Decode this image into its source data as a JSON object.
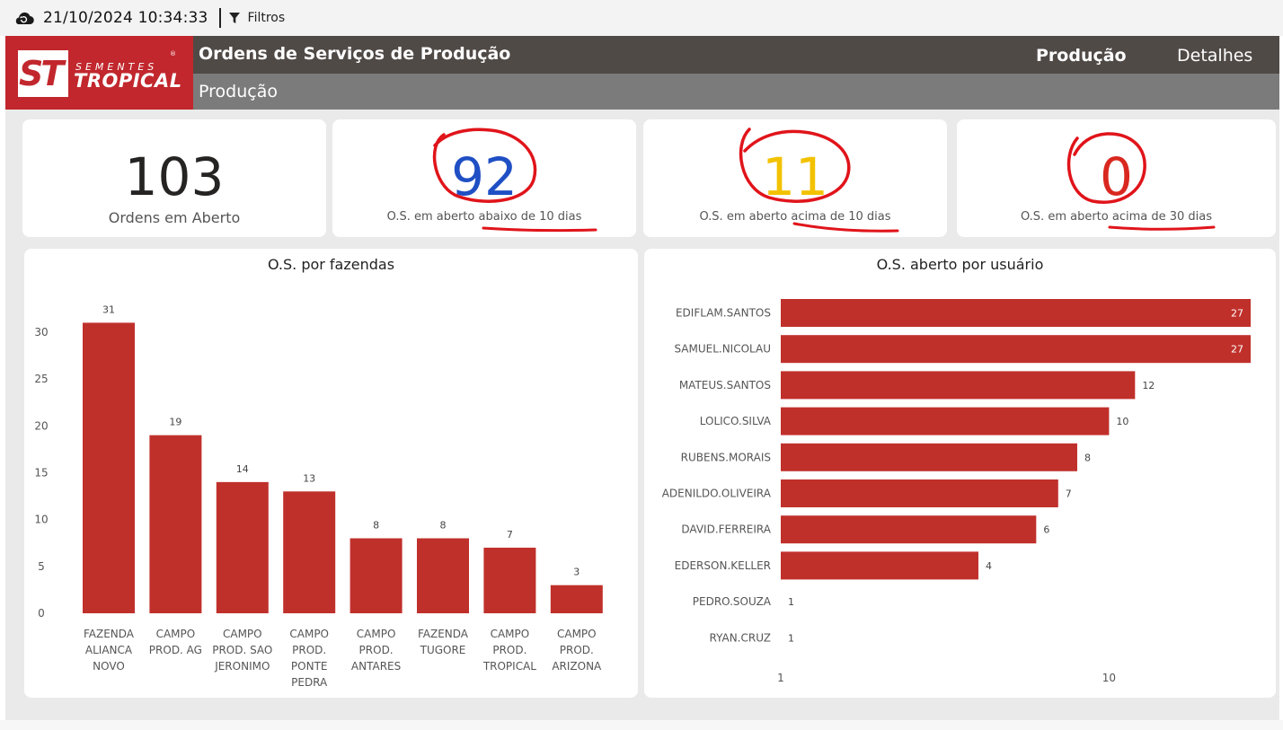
{
  "toolbar": {
    "refresh_icon": "cloud-refresh-icon",
    "timestamp": "21/10/2024 10:34:33",
    "filter_icon": "filter-icon",
    "filter_label": "Filtros"
  },
  "header": {
    "logo_mark": "ST",
    "logo_top": "SEMENTES",
    "logo_bottom": "TROPICAL",
    "logo_reg": "®",
    "title": "Ordens de Serviços de Produção",
    "subtitle": "Produção",
    "nav": [
      {
        "label": "Produção",
        "active": true
      },
      {
        "label": "Detalhes",
        "active": false
      }
    ]
  },
  "kpis": [
    {
      "value": "103",
      "label": "Ordens em Aberto",
      "color": "#252423"
    },
    {
      "value": "92",
      "label": "O.S. em aberto abaixo de 10 dias",
      "color": "#1f4fc4"
    },
    {
      "value": "11",
      "label": "O.S. em aberto acima de 10 dias",
      "color": "#f2c200"
    },
    {
      "value": "0",
      "label": "O.S. em aberto acima de 30 dias",
      "color": "#d9281f"
    }
  ],
  "colors": {
    "bar": "#c0302b",
    "accent_red": "#c1272d",
    "annotation_red": "#e0141a"
  },
  "chart_data": [
    {
      "type": "bar",
      "title": "O.S. por fazendas",
      "categories": [
        [
          "FAZENDA",
          "ALIANCA",
          "NOVO"
        ],
        [
          "CAMPO",
          "PROD. AG"
        ],
        [
          "CAMPO",
          "PROD. SAO",
          "JERONIMO"
        ],
        [
          "CAMPO",
          "PROD.",
          "PONTE",
          "PEDRA"
        ],
        [
          "CAMPO",
          "PROD.",
          "ANTARES"
        ],
        [
          "FAZENDA",
          "TUGORE"
        ],
        [
          "CAMPO",
          "PROD.",
          "TROPICAL"
        ],
        [
          "CAMPO",
          "PROD.",
          "ARIZONA"
        ]
      ],
      "values": [
        31,
        19,
        14,
        13,
        8,
        8,
        7,
        3
      ],
      "ylim": [
        0,
        32
      ],
      "yticks": [
        0,
        5,
        10,
        15,
        20,
        25,
        30
      ],
      "grid": false,
      "data_labels": true
    },
    {
      "type": "bar",
      "orientation": "horizontal",
      "title": "O.S. aberto por usuário",
      "categories": [
        "EDIFLAM.SANTOS",
        "SAMUEL.NICOLAU",
        "MATEUS.SANTOS",
        "LOLICO.SILVA",
        "RUBENS.MORAIS",
        "ADENILDO.OLIVEIRA",
        "DAVID.FERREIRA",
        "EDERSON.KELLER",
        "PEDRO.SOUZA",
        "RYAN.CRUZ"
      ],
      "values": [
        27,
        27,
        12,
        10,
        8,
        7,
        6,
        4,
        1,
        1
      ],
      "xscale": "log",
      "xlim": [
        1,
        27
      ],
      "xticks": [
        1,
        10
      ],
      "grid": false,
      "data_labels": true
    }
  ]
}
